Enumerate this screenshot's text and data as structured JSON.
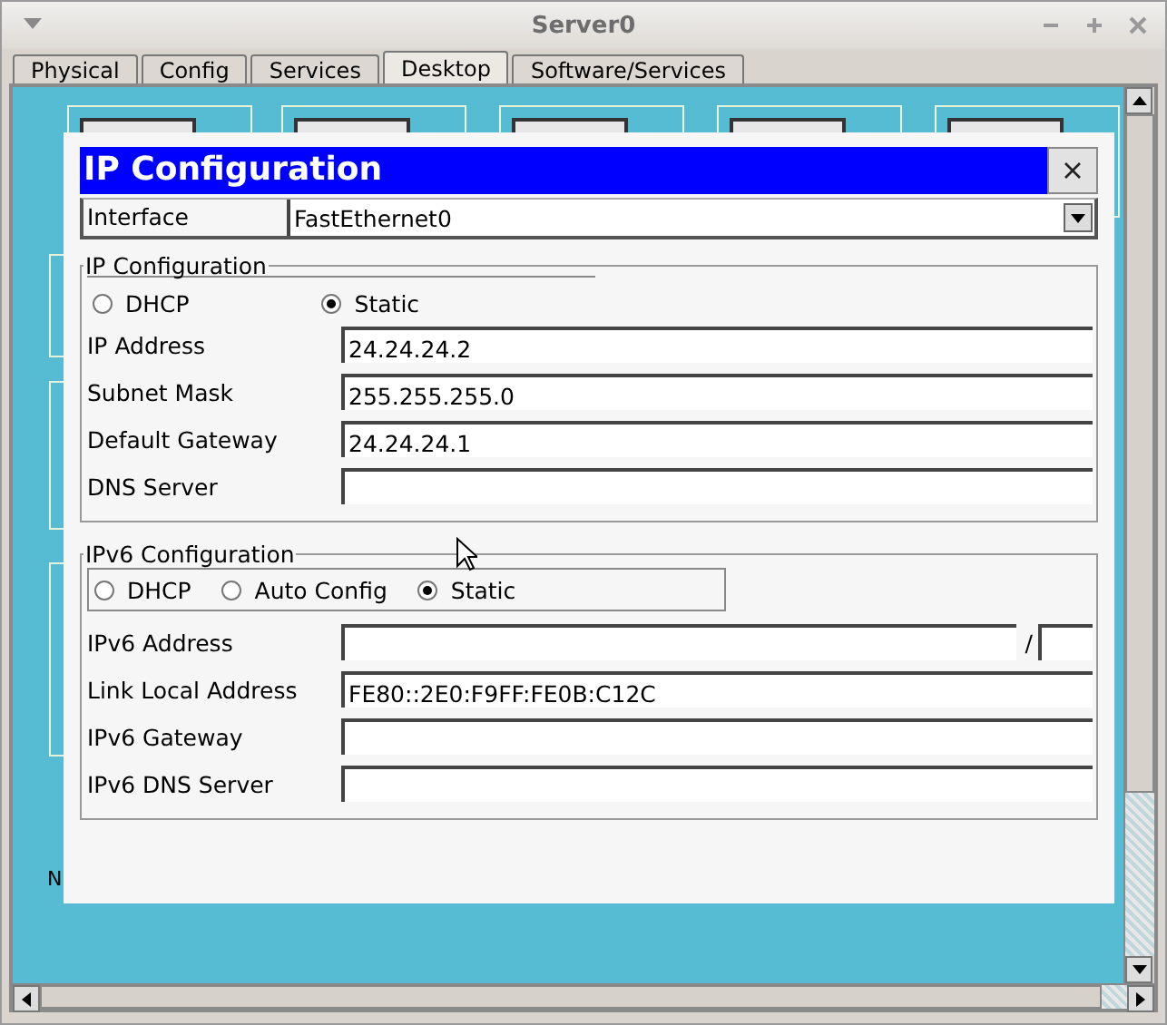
{
  "window": {
    "title": "Server0"
  },
  "tabs": [
    {
      "label": "Physical",
      "selected": false
    },
    {
      "label": "Config",
      "selected": false
    },
    {
      "label": "Services",
      "selected": false
    },
    {
      "label": "Desktop",
      "selected": true
    },
    {
      "label": "Software/Services",
      "selected": false
    }
  ],
  "desktop": {
    "partial_label": "N"
  },
  "dialog": {
    "title": "IP Configuration",
    "interface": {
      "label": "Interface",
      "value": "FastEthernet0"
    },
    "ipv4": {
      "title": "IP Configuration",
      "modes": [
        {
          "label": "DHCP",
          "selected": false
        },
        {
          "label": "Static",
          "selected": true
        }
      ],
      "fields": [
        {
          "label": "IP Address",
          "value": "24.24.24.2"
        },
        {
          "label": "Subnet Mask",
          "value": "255.255.255.0"
        },
        {
          "label": "Default Gateway",
          "value": "24.24.24.1"
        },
        {
          "label": "DNS Server"
        }
      ]
    },
    "ipv6": {
      "title": "IPv6 Configuration",
      "modes": [
        {
          "label": "DHCP",
          "selected": false
        },
        {
          "label": "Auto Config",
          "selected": false
        },
        {
          "label": "Static",
          "selected": true
        }
      ],
      "fields": [
        {
          "label": "IPv6 Address",
          "kind": "prefixed",
          "separator": "/"
        },
        {
          "label": "Link Local Address",
          "value": "FE80::2E0:F9FF:FE0B:C12C"
        },
        {
          "label": "IPv6 Gateway"
        },
        {
          "label": "IPv6 DNS Server"
        }
      ]
    }
  }
}
